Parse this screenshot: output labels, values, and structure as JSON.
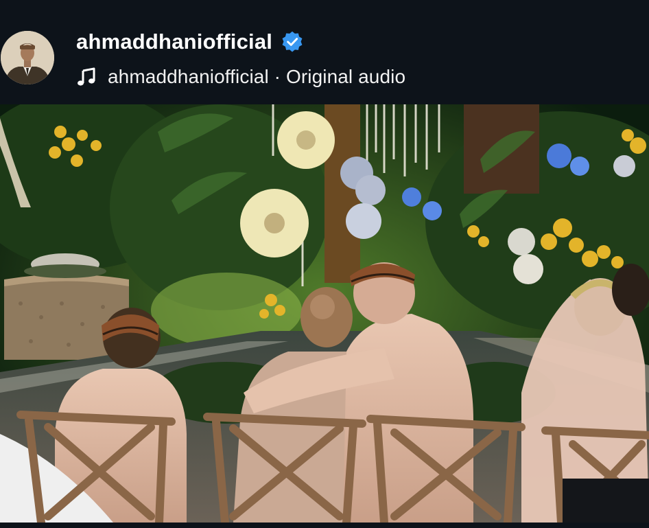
{
  "post": {
    "username": "ahmaddhaniofficial",
    "verified": true,
    "audio_label": "ahmaddhaniofficial · Original audio"
  },
  "icons": {
    "avatar": "profile-avatar",
    "verified": "verified-badge-icon",
    "audio": "music-note-icon"
  },
  "colors": {
    "background": "#0d131a",
    "verified_badge": "#3897f0",
    "text": "#ffffff"
  }
}
